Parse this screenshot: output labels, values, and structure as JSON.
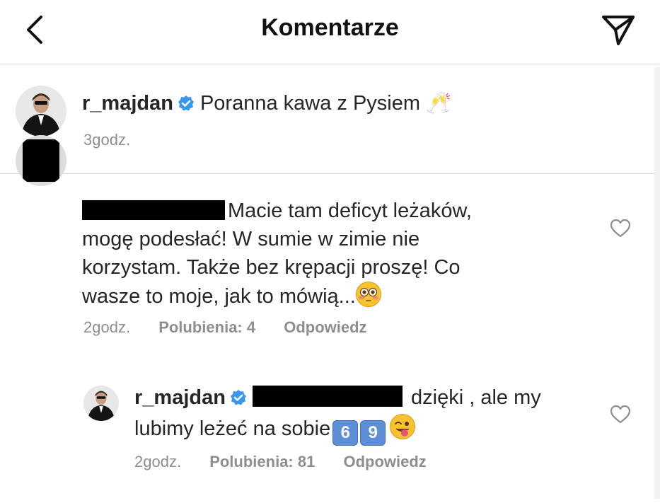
{
  "header": {
    "title": "Komentarze",
    "back_icon": "chevron-left-icon",
    "send_icon": "paper-plane-icon"
  },
  "post": {
    "username": "r_majdan",
    "caption": "Poranna kawa z Pysiem",
    "caption_emoji": "🥂",
    "time": "3godz."
  },
  "comment": {
    "text_line1": "Macie tam deficyt leżaków,",
    "text_line2": "mogę podesłać! W sumie w zimie nie",
    "text_line3": "korzystam. Także bez krępacji proszę! Co",
    "text_line4": "wasze to moje, jak to mówią...",
    "emoji": "😳",
    "time": "2godz.",
    "likes": "Polubienia: 4",
    "reply": "Odpowiedz"
  },
  "reply": {
    "username": "r_majdan",
    "text_line1": "dzięki , ale my",
    "text_line2": "lubimy leżeć na sobie",
    "keycap1": "6",
    "keycap2": "9",
    "emoji": "😜",
    "time": "2godz.",
    "likes": "Polubienia: 81",
    "reply": "Odpowiedz"
  },
  "colors": {
    "text": "#262626",
    "muted": "#8e8e8e",
    "verified": "#3897f0",
    "divider": "#dbdbdb"
  }
}
